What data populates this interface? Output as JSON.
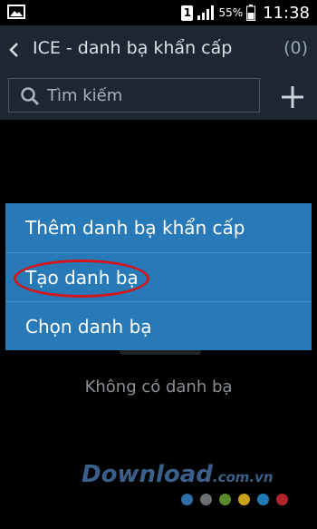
{
  "status_bar": {
    "sim_slot": "1",
    "battery_percent": "55%",
    "time": "11:38"
  },
  "action_bar": {
    "title": "ICE - danh bạ khẩn cấp",
    "count": "(0)"
  },
  "search": {
    "placeholder": "Tìm kiếm"
  },
  "popup_menu": {
    "items": [
      {
        "label": "Thêm danh bạ khẩn cấp"
      },
      {
        "label": "Tạo danh bạ"
      },
      {
        "label": "Chọn danh bạ"
      }
    ],
    "background": "#2779b7",
    "highlight_color": "#d3171c"
  },
  "empty_state": {
    "text": "Không có danh bạ"
  },
  "watermark": {
    "main": "Download",
    "suffix": ".com.vn",
    "dot_colors": [
      "#2f6ea6",
      "#6b6f73",
      "#5a8a2a",
      "#c8a21a",
      "#1f7ab8",
      "#b3232a"
    ]
  },
  "colors": {
    "action_bar": "#1c2731",
    "background": "#000000"
  }
}
